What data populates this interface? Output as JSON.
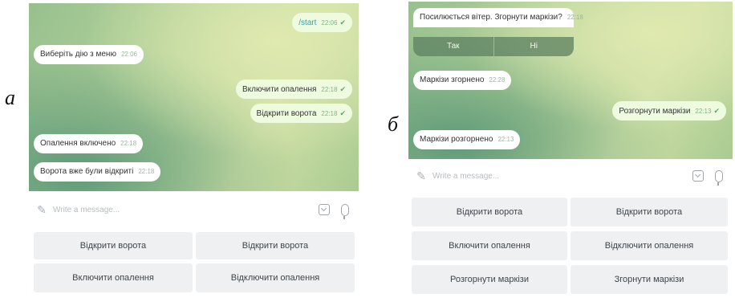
{
  "labels": {
    "a": "а",
    "b": "б"
  },
  "panel_a": {
    "messages": [
      {
        "text": "/start",
        "time": "22:06",
        "dir": "out"
      },
      {
        "text": "Виберіть дію з меню",
        "time": "22:06",
        "dir": "in"
      },
      {
        "text": "Включити опалення",
        "time": "22:18",
        "dir": "out"
      },
      {
        "text": "Відкрити ворота",
        "time": "22:18",
        "dir": "out"
      },
      {
        "text": "Опалення включено",
        "time": "22:18",
        "dir": "in"
      },
      {
        "text": "Ворота вже були відкриті",
        "time": "22:18",
        "dir": "in"
      }
    ],
    "input_placeholder": "Write a message...",
    "keyboard": [
      "Відкрити ворота",
      "Відкрити ворота",
      "Включити опалення",
      "Відключити опалення"
    ]
  },
  "panel_b": {
    "question": {
      "text": "Посилюється вітер. Згорнути маркізи?",
      "time": "22:18"
    },
    "inline_buttons": [
      "Так",
      "Ні"
    ],
    "messages": [
      {
        "text": "Маркізи згорнено",
        "time": "22:28",
        "dir": "in"
      },
      {
        "text": "Розгорнути маркізи",
        "time": "22:13",
        "dir": "out"
      },
      {
        "text": "Маркізи розгорнено",
        "time": "22:13",
        "dir": "in"
      }
    ],
    "input_placeholder": "Write a message...",
    "keyboard": [
      "Відкрити ворота",
      "Відкрити ворота",
      "Включити опалення",
      "Відключити опалення",
      "Розгорнути маркізи",
      "Згорнути маркізи"
    ]
  },
  "colors": {
    "bubble_in": "#ffffff",
    "bubble_out": "#eefbdf",
    "inline_button": "#5c8060",
    "keyboard_button": "#eef0f2"
  },
  "icons": {
    "attach": "paperclip-icon",
    "keyboard": "keyboard-icon",
    "mic": "microphone-icon",
    "read": "check-icon"
  }
}
